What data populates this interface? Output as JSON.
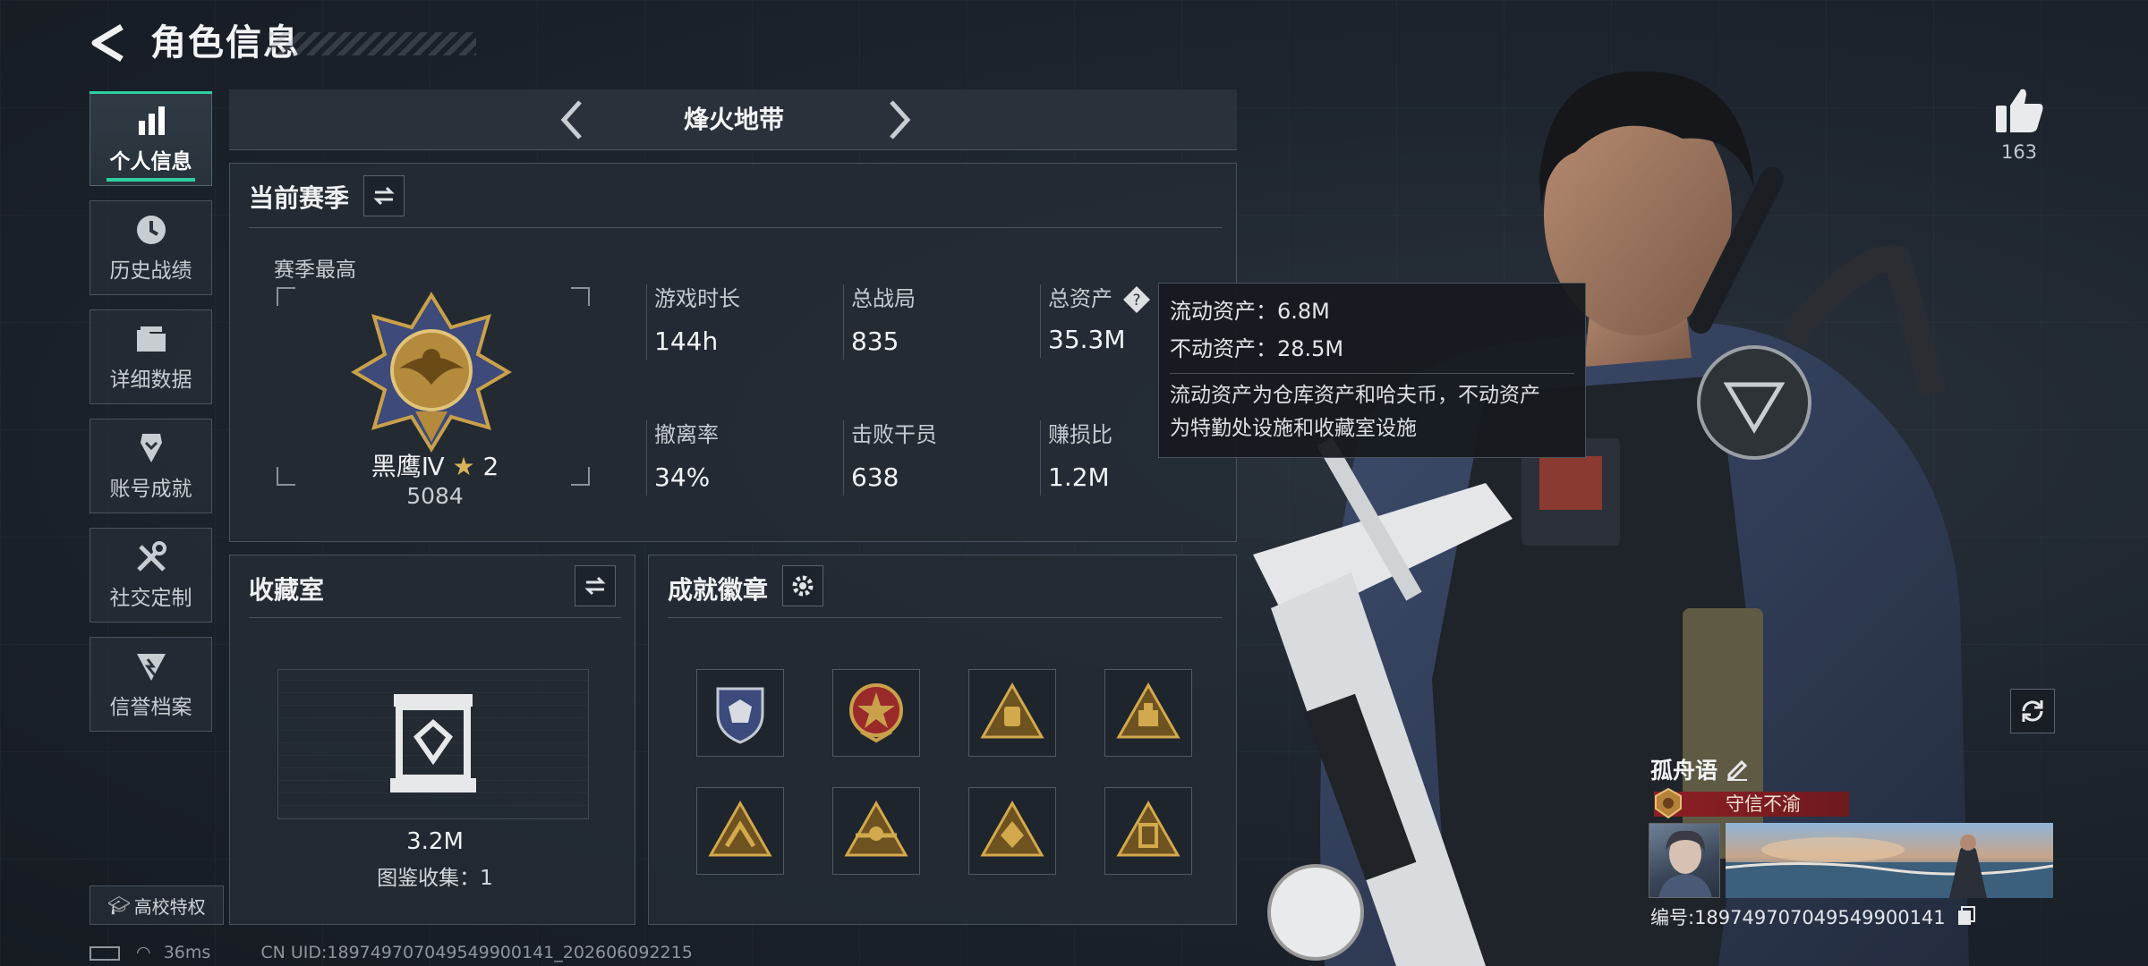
{
  "header": {
    "title": "角色信息"
  },
  "sidebar": {
    "items": [
      {
        "label": "个人信息",
        "icon": "bar-chart-icon"
      },
      {
        "label": "历史战绩",
        "icon": "clock-icon"
      },
      {
        "label": "详细数据",
        "icon": "folder-icon"
      },
      {
        "label": "账号成就",
        "icon": "trophy-icon"
      },
      {
        "label": "社交定制",
        "icon": "tools-icon"
      },
      {
        "label": "信誉档案",
        "icon": "credit-icon"
      }
    ],
    "school_label": "高校特权"
  },
  "mode": {
    "name": "烽火地带"
  },
  "season": {
    "title": "当前赛季",
    "best_label": "赛季最高",
    "rank_name": "黑鹰Ⅳ",
    "rank_stars": "2",
    "rank_score": "5084",
    "stats": [
      {
        "label": "游戏时长",
        "value": "144h"
      },
      {
        "label": "总战局",
        "value": "835"
      },
      {
        "label": "总资产",
        "value": "35.3M"
      },
      {
        "label": "撤离率",
        "value": "34%"
      },
      {
        "label": "击败干员",
        "value": "638"
      },
      {
        "label": "赚损比",
        "value": "1.2M"
      }
    ]
  },
  "tooltip": {
    "liquid": "流动资产：6.8M",
    "fixed": "不动资产：28.5M",
    "desc_line1": "流动资产为仓库资产和哈夫币，不动资产",
    "desc_line2": "为特勤处设施和收藏室设施"
  },
  "collection": {
    "title": "收藏室",
    "value": "3.2M",
    "count_text": "图鉴收集：1"
  },
  "achievements": {
    "title": "成就徽章",
    "badges": [
      "shield-badge-icon",
      "star-medal-badge-icon",
      "triangle-badge-icon",
      "triangle-badge-icon",
      "triangle-badge-icon",
      "triangle-badge-icon",
      "triangle-badge-icon",
      "triangle-badge-icon"
    ]
  },
  "social": {
    "likes": "163"
  },
  "player": {
    "name": "孤舟语",
    "title_tag": "守信不渝",
    "id_text": "编号:1897497070495499001​41"
  },
  "status": {
    "ping": "36ms",
    "uid": "CN UID:18974970704954990014​1_202606092215"
  },
  "colors": {
    "accent": "#2ecf9e",
    "gold": "#c9a14a",
    "red_tag": "#8d1f24"
  }
}
